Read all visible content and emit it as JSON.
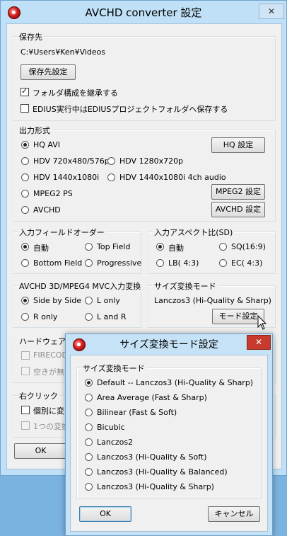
{
  "main": {
    "title": "AVCHD converter 設定",
    "close_glyph": "✕",
    "save": {
      "group": "保存先",
      "path": "C:¥Users¥Ken¥Videos",
      "button": "保存先設定",
      "inherit_folder": "フォルダ構成を継承する",
      "inherit_checked": true,
      "edius_save": "EDIUS実行中はEDIUSプロジェクトフォルダへ保存する",
      "edius_checked": false
    },
    "output": {
      "group": "出力形式",
      "options": [
        "HQ AVI",
        "HDV 720x480/576p",
        "HDV 1280x720p",
        "HDV 1440x1080i",
        "HDV 1440x1080i 4ch audio",
        "MPEG2 PS",
        "AVCHD"
      ],
      "selected": "HQ AVI",
      "hq_button": "HQ 設定",
      "mpeg2_button": "MPEG2 設定",
      "avchd_button": "AVCHD 設定"
    },
    "field_order": {
      "group": "入力フィールドオーダー",
      "options": [
        "自動",
        "Top Field",
        "Bottom Field",
        "Progressive"
      ],
      "selected": "自動"
    },
    "aspect": {
      "group": "入力アスペクト比(SD)",
      "options": [
        "自動",
        "SQ(16:9)",
        "LB( 4:3)",
        "EC( 4:3)"
      ],
      "selected": "自動"
    },
    "mvc": {
      "group": "AVCHD 3D/MPEG4 MVC入力変換",
      "options": [
        "Side by Side",
        "L only",
        "R only",
        "L and R"
      ],
      "selected": "Side by Side"
    },
    "resize_mode": {
      "group": "サイズ変換モード",
      "current": "Lanczos3 (Hi-Quality & Sharp)",
      "button": "モード設定"
    },
    "hardware": {
      "group": "ハードウェア",
      "item1": "FIRECODE",
      "item2": "空きが無い"
    },
    "right_click": {
      "group": "右クリック",
      "item1": "個別に変",
      "item2": "1つの変換"
    },
    "ok": "OK"
  },
  "dialog": {
    "title": "サイズ変換モード設定",
    "close_glyph": "✕",
    "group": "サイズ変換モード",
    "options": [
      "Default -- Lanczos3 (Hi-Quality & Sharp)",
      "Area Average (Fast & Sharp)",
      "Bilinear (Fast & Soft)",
      "Bicubic",
      "Lanczos2",
      "Lanczos3 (Hi-Quality & Soft)",
      "Lanczos3 (Hi-Quality & Balanced)",
      "Lanczos3 (Hi-Quality & Sharp)"
    ],
    "selected_index": 0,
    "ok": "OK",
    "cancel": "キャンセル"
  }
}
